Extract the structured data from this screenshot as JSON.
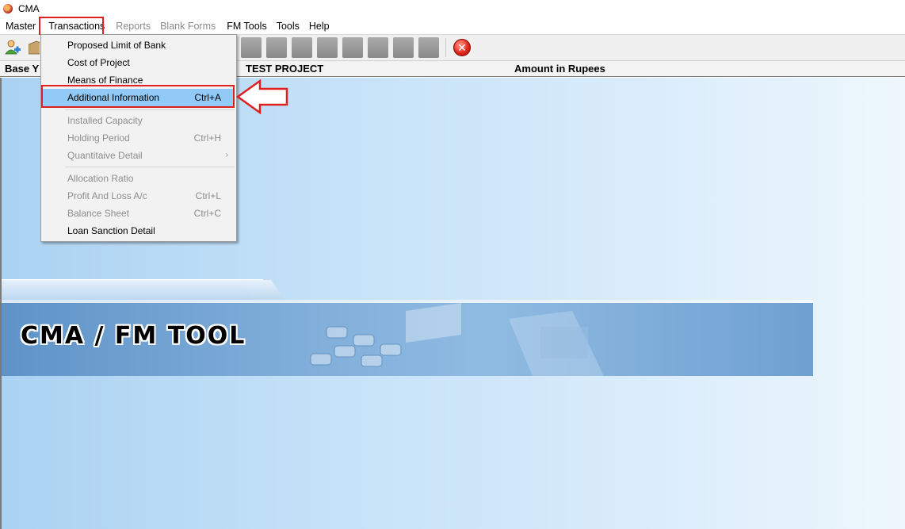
{
  "window": {
    "title": "CMA"
  },
  "menubar": {
    "items": [
      {
        "label": "Master",
        "disabled": false
      },
      {
        "label": "Transactions",
        "disabled": false
      },
      {
        "label": "Reports",
        "disabled": true
      },
      {
        "label": "Blank Forms",
        "disabled": true
      },
      {
        "label": "FM Tools",
        "disabled": false
      },
      {
        "label": "Tools",
        "disabled": false
      },
      {
        "label": "Help",
        "disabled": false
      }
    ]
  },
  "toolbar": {
    "icons": [
      "add-user-icon",
      "package-icon",
      "toolbar-button-icon",
      "exit-icon"
    ]
  },
  "header": {
    "left_label": "Base Y",
    "project": "TEST PROJECT",
    "amount": "Amount in Rupees"
  },
  "transactions_menu": {
    "items": [
      {
        "label": "Proposed Limit of Bank",
        "shortcut": "",
        "disabled": false
      },
      {
        "label": "Cost of Project",
        "shortcut": "",
        "disabled": false
      },
      {
        "label": "Means of Finance",
        "shortcut": "",
        "disabled": false
      },
      {
        "label": "Additional Information",
        "shortcut": "Ctrl+A",
        "disabled": false,
        "selected": true
      },
      {
        "label": "Installed Capacity",
        "shortcut": "",
        "disabled": true
      },
      {
        "label": "Holding Period",
        "shortcut": "Ctrl+H",
        "disabled": true
      },
      {
        "label": "Quantitaive Detail",
        "shortcut": "",
        "disabled": true,
        "submenu": true
      },
      {
        "label": "Allocation Ratio",
        "shortcut": "",
        "disabled": true
      },
      {
        "label": "Profit And Loss A/c",
        "shortcut": "Ctrl+L",
        "disabled": true
      },
      {
        "label": "Balance Sheet",
        "shortcut": "Ctrl+C",
        "disabled": true
      },
      {
        "label": "Loan Sanction Detail",
        "shortcut": "",
        "disabled": false
      }
    ]
  },
  "banner": {
    "title": "CMA / FM TOOL"
  },
  "colors": {
    "highlight": "#e02020",
    "selected": "#91c9f7",
    "background": "#c4e1f8"
  }
}
